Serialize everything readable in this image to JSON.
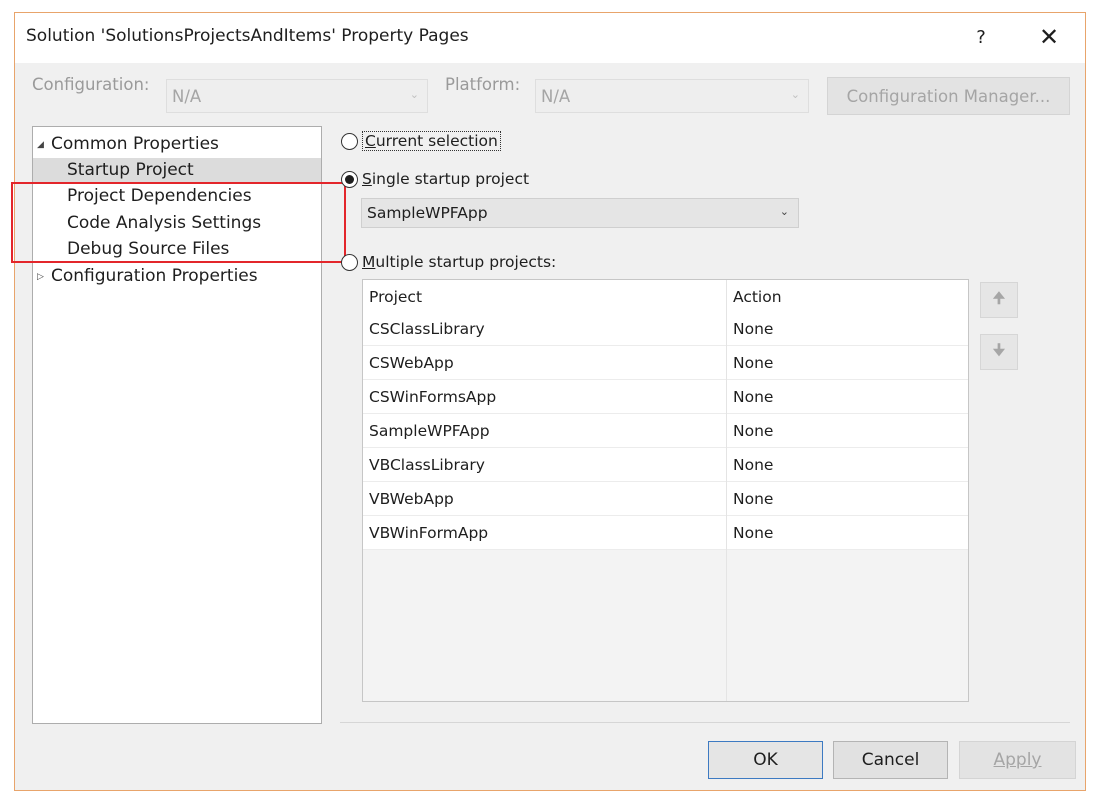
{
  "window": {
    "title": "Solution 'SolutionsProjectsAndItems' Property Pages",
    "help_label": "?",
    "close_label": "✕"
  },
  "config_bar": {
    "configuration_label": "Configuration:",
    "configuration_value": "N/A",
    "platform_label": "Platform:",
    "platform_value": "N/A",
    "manager_button": "Configuration Manager..."
  },
  "tree": {
    "common": {
      "label": "Common Properties",
      "children": [
        "Startup Project",
        "Project Dependencies",
        "Code Analysis Settings",
        "Debug Source Files"
      ],
      "selected": "Startup Project"
    },
    "configuration": {
      "label": "Configuration Properties"
    }
  },
  "startup": {
    "current_selection": {
      "prefix": "C",
      "rest": "urrent selection"
    },
    "single": {
      "prefix": "S",
      "rest": "ingle startup project"
    },
    "single_project": "SampleWPFApp",
    "multiple": {
      "prefix": "M",
      "rest": "ultiple startup projects:"
    },
    "selected_option": "single"
  },
  "grid": {
    "headers": [
      "Project",
      "Action"
    ],
    "rows": [
      {
        "project": "CSClassLibrary",
        "action": "None"
      },
      {
        "project": "CSWebApp",
        "action": "None"
      },
      {
        "project": "CSWinFormsApp",
        "action": "None"
      },
      {
        "project": "SampleWPFApp",
        "action": "None"
      },
      {
        "project": "VBClassLibrary",
        "action": "None"
      },
      {
        "project": "VBWebApp",
        "action": "None"
      },
      {
        "project": "VBWinFormApp",
        "action": "None"
      }
    ]
  },
  "icons": {
    "move_up": "arrow-up-icon",
    "move_down": "arrow-down-icon",
    "dropdown": "chevron-down-icon"
  },
  "buttons": {
    "ok": "OK",
    "cancel": "Cancel",
    "apply": "Apply"
  },
  "colors": {
    "highlight_border": "#e3262b",
    "ok_border": "#3d7ac2",
    "window_border": "#e8a46b"
  }
}
